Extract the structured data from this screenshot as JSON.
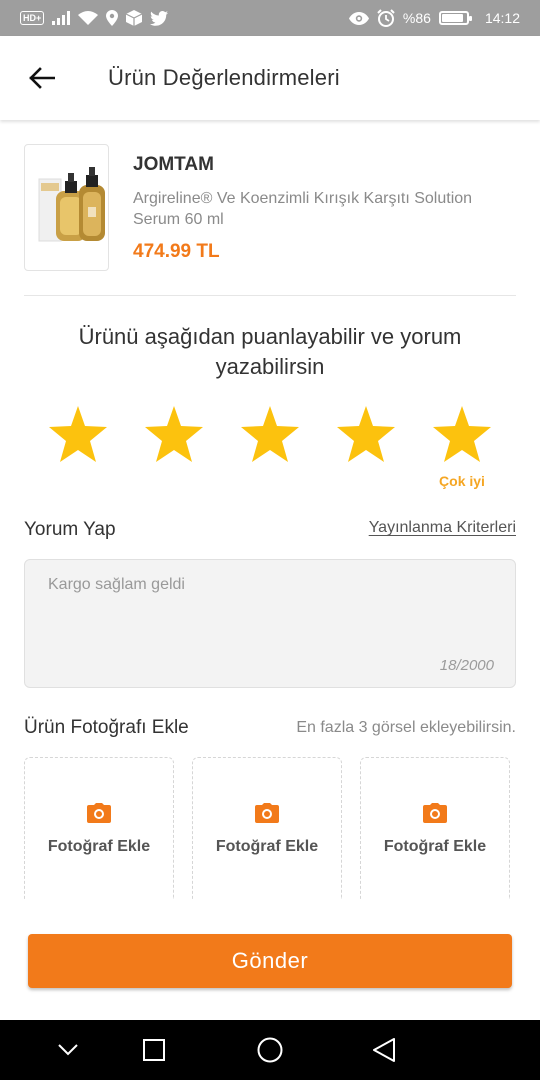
{
  "status_bar": {
    "hd_badge": "HD+",
    "battery_text": "%86",
    "battery_level": 0.86,
    "time": "14:12",
    "icons": [
      "signal-icon",
      "wifi-icon",
      "location-icon",
      "box-icon",
      "twitter-icon",
      "eye-icon",
      "alarm-icon",
      "battery-icon"
    ]
  },
  "header": {
    "title": "Ürün Değerlendirmeleri",
    "back_icon": "arrow-left-icon"
  },
  "product": {
    "brand": "JOMTAM",
    "name": "Argireline® Ve Koenzimli Kırışık Karşıtı Solution Serum 60 ml",
    "price": "474.99 TL",
    "image": "serum-bottle-image"
  },
  "rating": {
    "prompt": "Ürünü aşağıdan puanlayabilir ve yorum yazabilirsin",
    "stars_total": 5,
    "stars_selected": 5,
    "selected_label": "Çok iyi",
    "star_color": "#fcc20e"
  },
  "comment": {
    "heading": "Yorum Yap",
    "criteria_link": "Yayınlanma Kriterleri",
    "value": "Kargo sağlam geldi",
    "char_count": "18/2000"
  },
  "photos": {
    "heading": "Ürün Fotoğrafı Ekle",
    "hint": "En fazla 3 görsel ekleyebilirsin.",
    "slots": [
      {
        "label": "Fotoğraf Ekle",
        "icon": "camera-icon"
      },
      {
        "label": "Fotoğraf Ekle",
        "icon": "camera-icon"
      },
      {
        "label": "Fotoğraf Ekle",
        "icon": "camera-icon"
      }
    ]
  },
  "submit": {
    "label": "Gönder"
  },
  "nav_bar": {
    "icons": [
      "chevron-down-icon",
      "square-icon",
      "circle-icon",
      "triangle-back-icon"
    ]
  },
  "colors": {
    "accent": "#f27a1a",
    "star": "#fcc20e",
    "star_label": "#f5a623"
  }
}
